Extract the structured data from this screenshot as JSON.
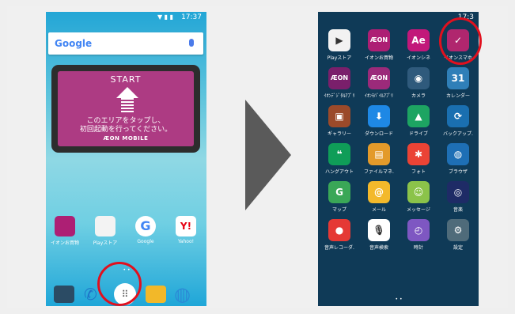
{
  "left": {
    "status_time": "17:37",
    "search_logo": "Google",
    "widget": {
      "title": "START",
      "line1": "このエリアをタップし、",
      "line2": "初回起動を行ってください。",
      "brand": "ÆON MOBILE"
    },
    "apps": [
      {
        "label": "イオンお買物",
        "icon": "aeon-shopping-icon",
        "color": "#ad1f74"
      },
      {
        "label": "Playストア",
        "icon": "play-store-icon",
        "color": "#ffffff"
      },
      {
        "label": "Google",
        "icon": "google-icon",
        "color": "#ffffff"
      },
      {
        "label": "Yahoo!",
        "icon": "yahoo-icon",
        "color": "#ffffff"
      }
    ],
    "page_dots": "• •",
    "dock": [
      {
        "icon": "camera-icon",
        "color": "#2b4b64"
      },
      {
        "icon": "phone-icon",
        "color": "#1e73c8"
      },
      {
        "icon": "app-drawer-icon",
        "color": "#ffffff"
      },
      {
        "icon": "messages-icon",
        "color": "#f2b829"
      },
      {
        "icon": "browser-icon",
        "color": "#2b8ad6"
      }
    ]
  },
  "right": {
    "status_time": "17:3",
    "apps": [
      {
        "label": "Playストア",
        "icon": "play-store-icon",
        "color": "#f2f2f2",
        "glyph": "▶"
      },
      {
        "label": "イオンお買物",
        "icon": "aeon-shopping-icon",
        "color": "#ad1f74",
        "glyph": "ÆON"
      },
      {
        "label": "イオンシネ",
        "icon": "aeon-cinema-icon",
        "color": "#c2187a",
        "glyph": "Ae"
      },
      {
        "label": "イオンスマホ",
        "icon": "aeon-smartphone-security-icon",
        "color": "#b0266e",
        "glyph": "✓"
      },
      {
        "label": "ｲｵﾝﾃﾞｼﾞﾀﾙｱﾌﾟﾘ",
        "icon": "aeon-digital-app-icon",
        "color": "#7a1f6b",
        "glyph": "ÆON"
      },
      {
        "label": "ｲｵﾝﾓﾊﾞｲﾙｱﾌﾟﾘ",
        "icon": "aeon-mobile-app-icon",
        "color": "#9b2a7a",
        "glyph": "ÆON"
      },
      {
        "label": "カメラ",
        "icon": "camera-icon",
        "color": "#2f5a7c",
        "glyph": "◉"
      },
      {
        "label": "カレンダー",
        "icon": "calendar-icon",
        "color": "#2f7fb8",
        "glyph": "31"
      },
      {
        "label": "ギャラリー",
        "icon": "gallery-icon",
        "color": "#9b4a2a",
        "glyph": "▣"
      },
      {
        "label": "ダウンロード",
        "icon": "download-icon",
        "color": "#1e88e5",
        "glyph": "⬇"
      },
      {
        "label": "ドライブ",
        "icon": "drive-icon",
        "color": "#1da462",
        "glyph": "▲"
      },
      {
        "label": "バックアップ.",
        "icon": "backup-icon",
        "color": "#1a6fb0",
        "glyph": "⟳"
      },
      {
        "label": "ハングアウト",
        "icon": "hangouts-icon",
        "color": "#0f9d58",
        "glyph": "❝"
      },
      {
        "label": "ファイルマネ.",
        "icon": "file-manager-icon",
        "color": "#e39a2a",
        "glyph": "▤"
      },
      {
        "label": "フォト",
        "icon": "photos-icon",
        "color": "#ea4335",
        "glyph": "✱"
      },
      {
        "label": "ブラウザ",
        "icon": "browser-icon",
        "color": "#1e6fb5",
        "glyph": "◍"
      },
      {
        "label": "マップ",
        "icon": "maps-icon",
        "color": "#3aa757",
        "glyph": "G"
      },
      {
        "label": "メール",
        "icon": "email-icon",
        "color": "#f3b92b",
        "glyph": "@"
      },
      {
        "label": "メッセージ",
        "icon": "messaging-icon",
        "color": "#8bc34a",
        "glyph": "☺"
      },
      {
        "label": "音楽",
        "icon": "music-icon",
        "color": "#1e2b66",
        "glyph": "◎"
      },
      {
        "label": "音声レコーダ.",
        "icon": "voice-recorder-icon",
        "color": "#e53935",
        "glyph": "●"
      },
      {
        "label": "音声検索",
        "icon": "voice-search-icon",
        "color": "#ffffff",
        "glyph": "🎙"
      },
      {
        "label": "時計",
        "icon": "clock-icon",
        "color": "#7e57c2",
        "glyph": "◴"
      },
      {
        "label": "設定",
        "icon": "settings-icon",
        "color": "#4f6b7a",
        "glyph": "⚙"
      }
    ],
    "page_dots": "• •"
  }
}
